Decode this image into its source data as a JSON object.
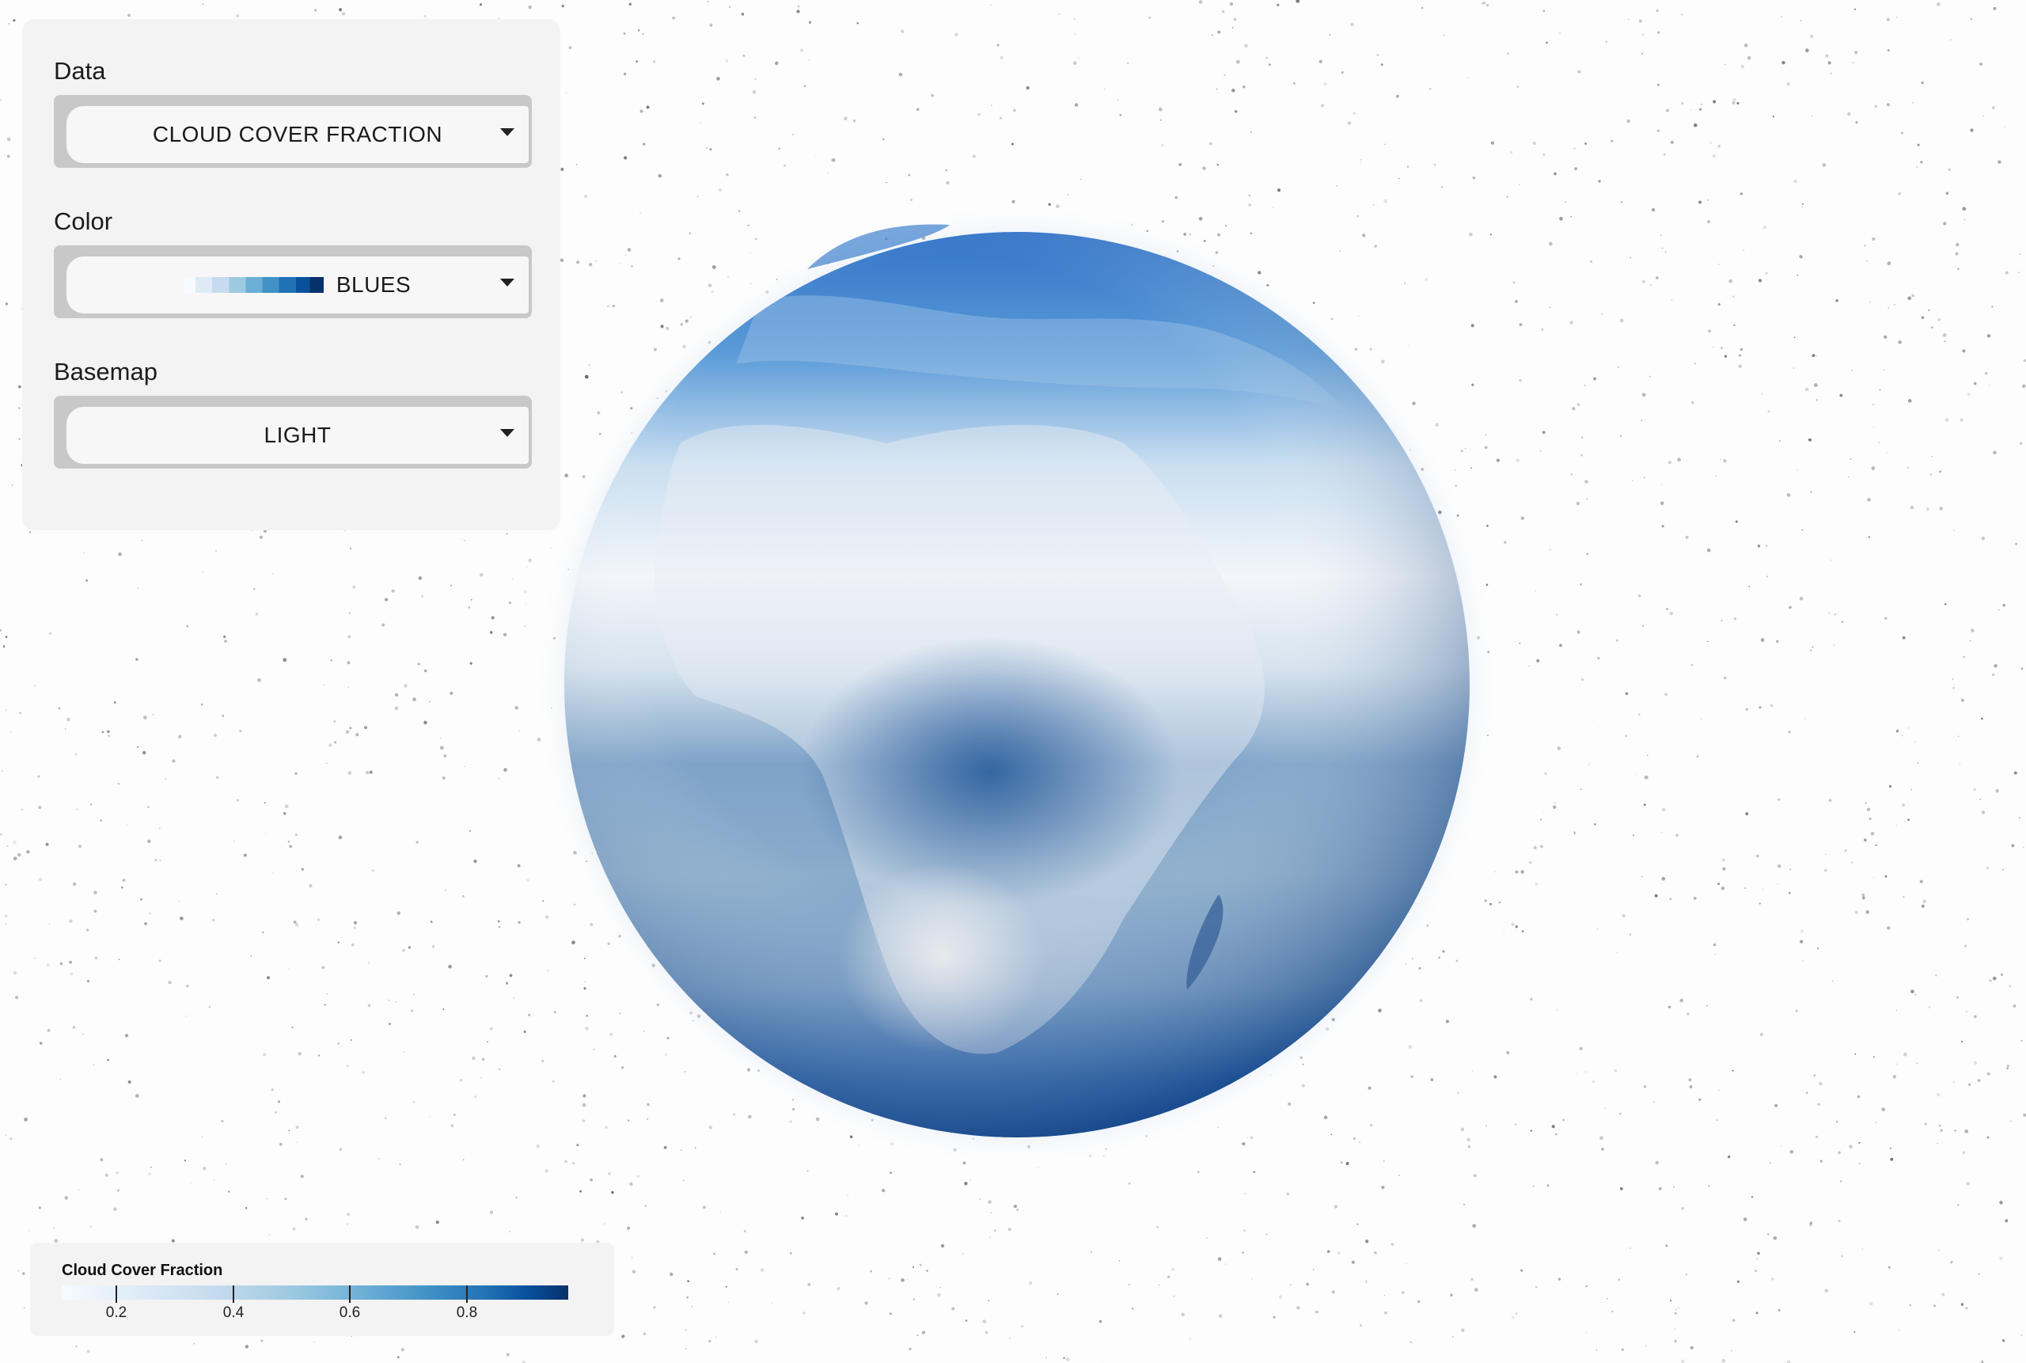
{
  "controls": {
    "data": {
      "label": "Data",
      "value": "CLOUD COVER FRACTION"
    },
    "color": {
      "label": "Color",
      "value": "BLUES",
      "ramp": [
        "#f7fbff",
        "#deebf7",
        "#c6dbef",
        "#9ecae1",
        "#6baed6",
        "#4292c6",
        "#2171b5",
        "#08519c",
        "#08306b"
      ]
    },
    "basemap": {
      "label": "Basemap",
      "value": "LIGHT"
    }
  },
  "legend": {
    "title": "Cloud Cover Fraction",
    "ticks": [
      "0.2",
      "0.4",
      "0.6",
      "0.8"
    ],
    "tick_values": [
      0.2,
      0.4,
      0.6,
      0.8
    ],
    "range": [
      0.05,
      0.98
    ]
  },
  "icons": {
    "dropdown": "chevron-down-icon"
  }
}
